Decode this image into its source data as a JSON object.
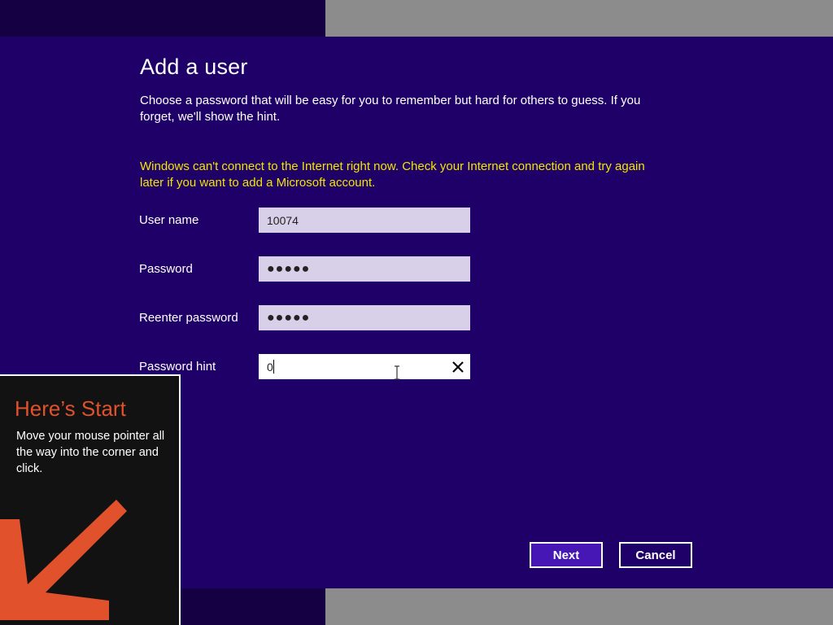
{
  "dialog": {
    "title": "Add a user",
    "description": "Choose a password that will be easy for you to remember but hard for others to guess. If you forget, we'll show the hint.",
    "warning": "Windows can't connect to the Internet right now. Check your Internet connection and try again later if you want to add a Microsoft account.",
    "background_color": "#1f0068",
    "warning_color": "#f2e600"
  },
  "form": {
    "username": {
      "label": "User name",
      "value": "10074"
    },
    "password": {
      "label": "Password",
      "value": "●●●●●"
    },
    "reenter_password": {
      "label": "Reenter password",
      "value": "●●●●●"
    },
    "password_hint": {
      "label": "Password hint",
      "value": "0"
    }
  },
  "buttons": {
    "next": "Next",
    "cancel": "Cancel"
  },
  "start_tip": {
    "title": "Here’s Start",
    "text": "Move your mouse pointer all the way into the corner and click.",
    "accent_color": "#e0512c"
  },
  "icons": {
    "clear": "close-icon",
    "arrow": "arrow-down-left-icon",
    "cursor": "ibeam-cursor-icon"
  }
}
